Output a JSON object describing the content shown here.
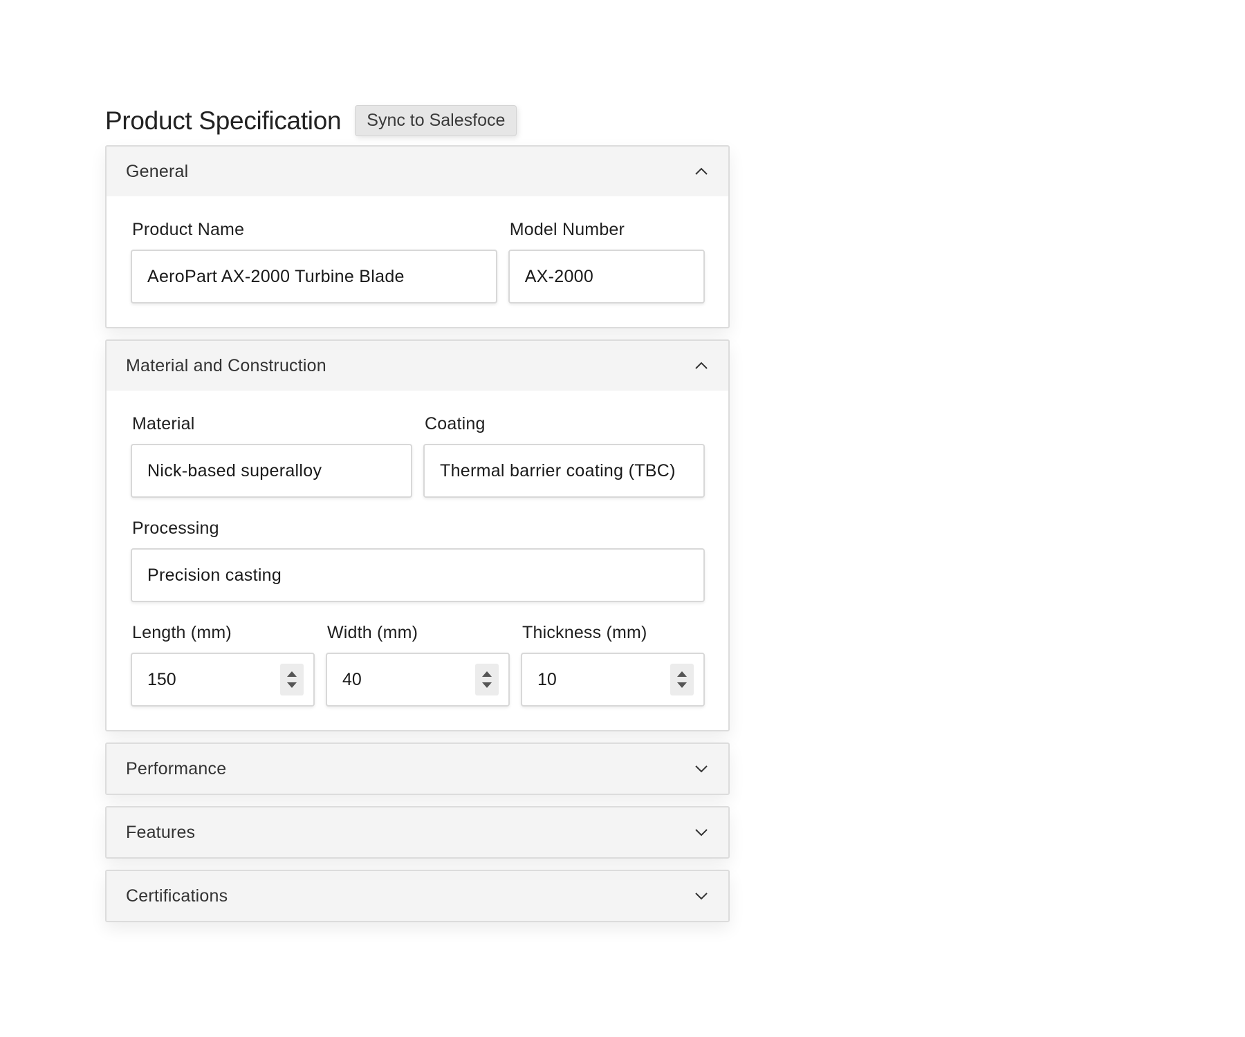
{
  "header": {
    "title": "Product Specification",
    "sync_label": "Sync to Salesfoce"
  },
  "sections": {
    "general": {
      "title": "General",
      "expanded": true,
      "chevron_icon": "chevron-up-icon",
      "product_name": {
        "label": "Product Name",
        "value": "AeroPart AX-2000 Turbine Blade"
      },
      "model_number": {
        "label": "Model Number",
        "value": "AX-2000"
      }
    },
    "material": {
      "title": "Material and Construction",
      "expanded": true,
      "chevron_icon": "chevron-up-icon",
      "material": {
        "label": "Material",
        "value": "Nick-based superalloy"
      },
      "coating": {
        "label": "Coating",
        "value": "Thermal barrier coating (TBC)"
      },
      "processing": {
        "label": "Processing",
        "value": "Precision casting"
      },
      "length": {
        "label": "Length (mm)",
        "value": "150"
      },
      "width": {
        "label": "Width (mm)",
        "value": "40"
      },
      "thickness": {
        "label": "Thickness (mm)",
        "value": "10"
      }
    },
    "performance": {
      "title": "Performance",
      "expanded": false,
      "chevron_icon": "chevron-down-icon"
    },
    "features": {
      "title": "Features",
      "expanded": false,
      "chevron_icon": "chevron-down-icon"
    },
    "certifications": {
      "title": "Certifications",
      "expanded": false,
      "chevron_icon": "chevron-down-icon"
    }
  },
  "colors": {
    "header_bg": "#f4f4f4",
    "border": "#dcdcdc",
    "button_bg": "#e6e6e6",
    "text": "#1a1a1a"
  }
}
